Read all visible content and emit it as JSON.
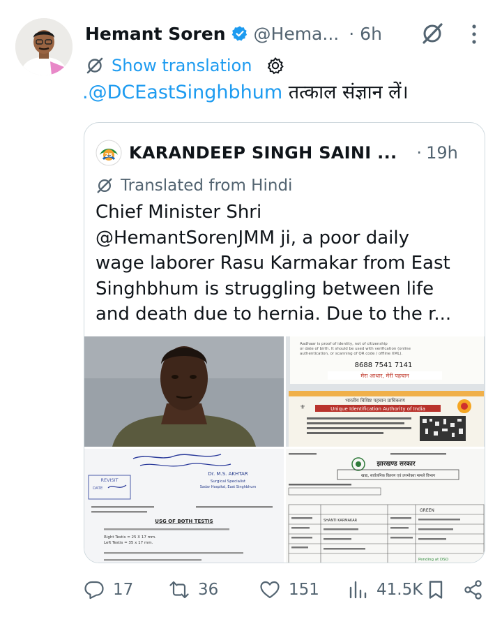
{
  "post": {
    "author_name": "Hemant Soren",
    "handle": "@Hema...",
    "separator": "·",
    "time": "6h",
    "show_translation": "Show translation",
    "text_mention": ".@DCEastSinghbhum",
    "text_rest": " तत्काल संज्ञान लें।"
  },
  "quote": {
    "author_name": "KARANDEEP SINGH SAINI ...",
    "separator": "·",
    "time": "19h",
    "translated_label": "Translated from Hindi",
    "body_lines": [
      "Chief Minister Shri",
      "@HemantSorenJMM ji, a poor daily",
      "wage laborer Rasu Karmakar from East",
      "Singhbhum is struggling between life",
      "and death due to hernia. Due to the r..."
    ],
    "media": {
      "aadhaar_back_text": "Aadhaar is proof of identity, not of citizenship or date of birth. It should be used with verification (online authentication, or scanning of QR code / offline XML).",
      "aadhaar_number": "8688 7541 7141",
      "aadhaar_tagline": "मेरा आधार, मेरी पहचान",
      "uidai_hindi": "भारतीय विशिष्ट पहचान प्राधिकरण",
      "uidai_english": "Unique Identification Authority of India",
      "doctor_name": "Dr. M.S. AKHTAR",
      "doctor_title": "Surgical Specialist",
      "doctor_hospital": "Sadar Hospital, East Singhbhum",
      "revisit_label": "REVISIT",
      "date_label": "DATE",
      "usg_heading": "USG OF BOTH TESTIS",
      "right_testis": "Right Testis = 25 X 17 mm.",
      "left_testis": "Left Testis = 35 x 17 mm.",
      "gov_hindi": "झारखण्ड सरकार",
      "gov_dept": "खाद्य, सार्वजनिक वितरण एवं उपभोक्ता मामले विभाग",
      "card_color": "GREEN",
      "card_holder": "SHANTI KARMAKAR",
      "status": "Pending at DSO"
    }
  },
  "actions": {
    "replies": "17",
    "reposts": "36",
    "likes": "151",
    "views": "41.5K"
  },
  "colors": {
    "accent": "#1d9bf0",
    "secondary_text": "#536471",
    "border": "#cfd9de"
  },
  "icons": [
    "verified-badge-icon",
    "grok-icon",
    "more-icon",
    "translate-icon",
    "gear-icon",
    "reply-icon",
    "repost-icon",
    "like-icon",
    "views-icon",
    "bookmark-icon",
    "share-icon"
  ]
}
